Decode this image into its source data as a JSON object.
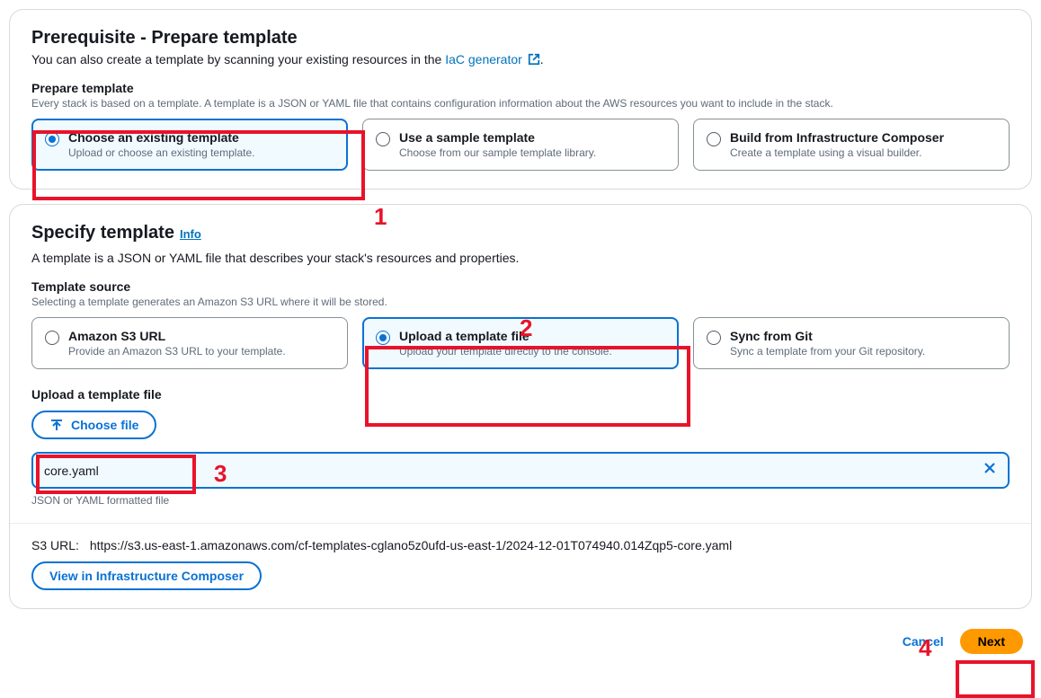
{
  "prereq": {
    "title": "Prerequisite - Prepare template",
    "subtitle_prefix": "You can also create a template by scanning your existing resources in the ",
    "link_text": "IaC generator",
    "subtitle_suffix": ".",
    "section_label": "Prepare template",
    "section_help": "Every stack is based on a template. A template is a JSON or YAML file that contains configuration information about the AWS resources you want to include in the stack.",
    "options": [
      {
        "title": "Choose an existing template",
        "desc": "Upload or choose an existing template.",
        "selected": true
      },
      {
        "title": "Use a sample template",
        "desc": "Choose from our sample template library.",
        "selected": false
      },
      {
        "title": "Build from Infrastructure Composer",
        "desc": "Create a template using a visual builder.",
        "selected": false
      }
    ]
  },
  "specify": {
    "title": "Specify template",
    "info": "Info",
    "subtitle": "A template is a JSON or YAML file that describes your stack's resources and properties.",
    "source_label": "Template source",
    "source_help": "Selecting a template generates an Amazon S3 URL where it will be stored.",
    "options": [
      {
        "title": "Amazon S3 URL",
        "desc": "Provide an Amazon S3 URL to your template.",
        "selected": false
      },
      {
        "title": "Upload a template file",
        "desc": "Upload your template directly to the console.",
        "selected": true
      },
      {
        "title": "Sync from Git",
        "desc": "Sync a template from your Git repository.",
        "selected": false
      }
    ],
    "upload_label": "Upload a template file",
    "choose_file": "Choose file",
    "filename": "core.yaml",
    "file_hint": "JSON or YAML formatted file",
    "s3_label": "S3 URL:",
    "s3_url": "https://s3.us-east-1.amazonaws.com/cf-templates-cglano5z0ufd-us-east-1/2024-12-01T074940.014Zqp5-core.yaml",
    "view_composer": "View in Infrastructure Composer"
  },
  "actions": {
    "cancel": "Cancel",
    "next": "Next"
  },
  "annotations": {
    "n1": "1",
    "n2": "2",
    "n3": "3",
    "n4": "4"
  }
}
